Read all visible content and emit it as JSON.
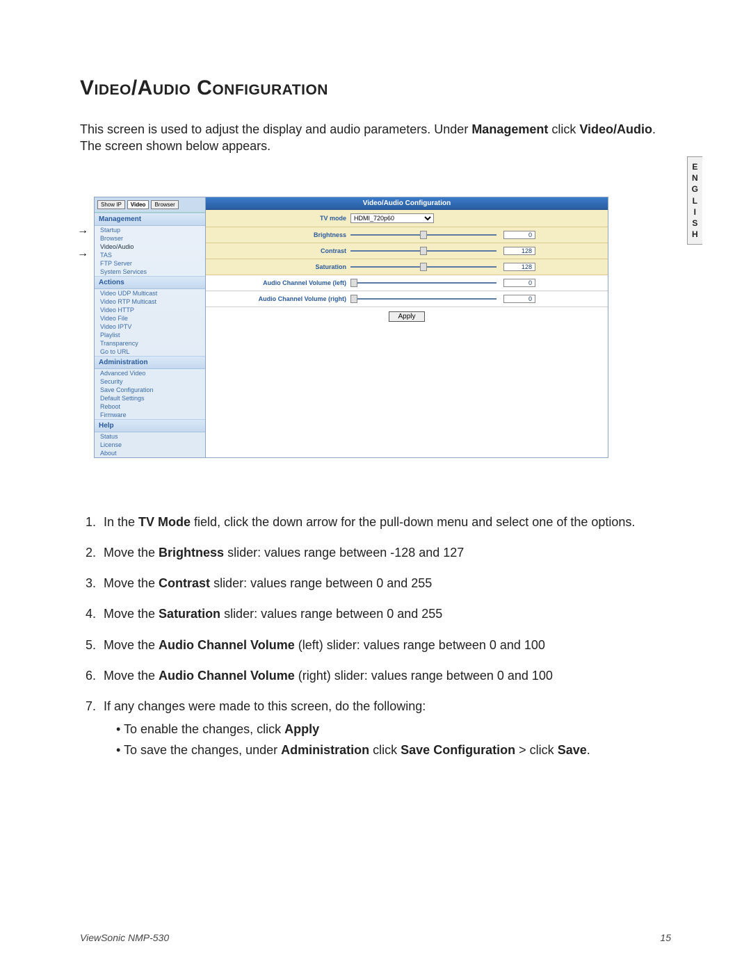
{
  "title": "Video/Audio Configuration",
  "intro_pre": "This screen is used to adjust the display and audio parameters. Under ",
  "intro_b1": "Management",
  "intro_mid": " click ",
  "intro_b2": "Video/Audio",
  "intro_post": ". The screen shown below appears.",
  "side_tab": "E\nN\nG\nL\nI\nS\nH",
  "shot": {
    "title": "Video/Audio Configuration",
    "sb_buttons": {
      "show_ip": "Show IP",
      "video": "Video",
      "browser": "Browser"
    },
    "sections": {
      "management": "Management",
      "management_items": [
        "Startup",
        "Browser",
        "Video/Audio",
        "TAS",
        "FTP Server",
        "System Services"
      ],
      "actions": "Actions",
      "actions_items": [
        "Video UDP Multicast",
        "Video RTP Multicast",
        "Video HTTP",
        "Video File",
        "Video IPTV",
        "Playlist",
        "Transparency",
        "Go to URL"
      ],
      "admin": "Administration",
      "admin_items": [
        "Advanced Video",
        "Security",
        "Save Configuration",
        "Default Settings",
        "Reboot",
        "Firmware"
      ],
      "help": "Help",
      "help_items": [
        "Status",
        "License",
        "About"
      ]
    },
    "rows": {
      "tvmode_label": "TV mode",
      "tvmode_value": "HDMI_720p60",
      "brightness_label": "Brightness",
      "brightness_value": "0",
      "contrast_label": "Contrast",
      "contrast_value": "128",
      "saturation_label": "Saturation",
      "saturation_value": "128",
      "acv_left_label": "Audio Channel Volume (left)",
      "acv_left_value": "0",
      "acv_right_label": "Audio Channel Volume (right)",
      "acv_right_value": "0",
      "apply": "Apply"
    }
  },
  "steps": {
    "s1_a": "In the ",
    "s1_b": "TV Mode",
    "s1_c": " field, click the down arrow for the pull-down menu and select one of the options.",
    "s2_a": "Move the ",
    "s2_b": "Brightness",
    "s2_c": " slider: values range between -128 and 127",
    "s3_a": "Move the ",
    "s3_b": "Contrast",
    "s3_c": " slider: values range between 0 and 255",
    "s4_a": "Move the ",
    "s4_b": "Saturation",
    "s4_c": " slider: values range between 0 and 255",
    "s5_a": "Move the ",
    "s5_b": "Audio Channel Volume",
    "s5_c": " (left) slider: values range between 0 and 100",
    "s6_a": "Move the ",
    "s6_b": "Audio Channel Volume",
    "s6_c": " (right) slider: values range between 0 and 100",
    "s7": "If any changes were made to this screen, do the following:",
    "s7_1a": "To enable the changes, click ",
    "s7_1b": "Apply",
    "s7_2a": "To save the changes, under ",
    "s7_2b": "Administration",
    "s7_2c": " click ",
    "s7_2d": "Save Configuration",
    "s7_2e": " > click ",
    "s7_2f": "Save",
    "s7_2g": "."
  },
  "footer": {
    "left": "ViewSonic NMP-530",
    "right": "15"
  }
}
